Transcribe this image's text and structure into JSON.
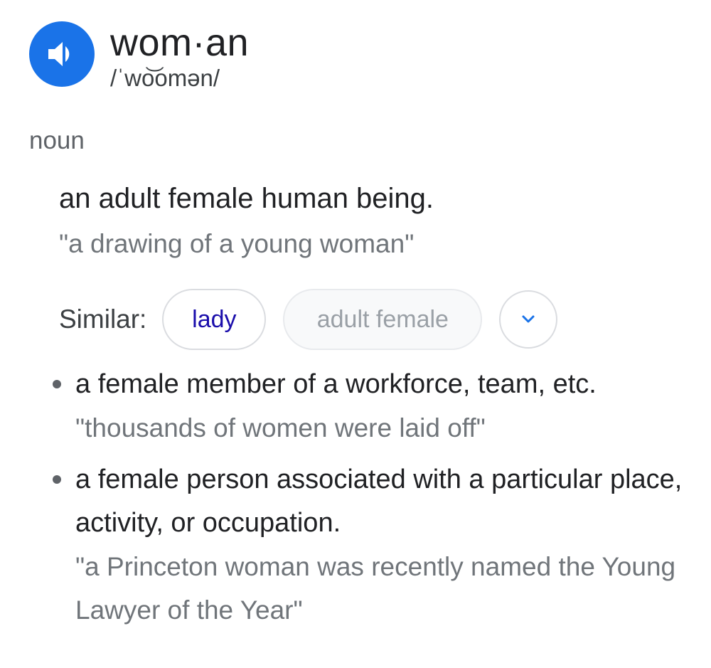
{
  "entry": {
    "headword": "wom·an",
    "pronunciation": "/ˈwo͝omən/",
    "part_of_speech": "noun",
    "speaker_icon": "speaker-volume-icon",
    "accent_color": "#1a73e8"
  },
  "primary_sense": {
    "definition": "an adult female human being.",
    "example": "\"a drawing of a young woman\""
  },
  "similar": {
    "label": "Similar:",
    "chips": [
      "lady",
      "adult female"
    ],
    "expand_icon": "chevron-down-icon"
  },
  "sub_senses": [
    {
      "definition": "a female member of a workforce, team, etc.",
      "example": "\"thousands of women were laid off\""
    },
    {
      "definition": "a female person associated with a particular place, activity, or occupation.",
      "example": "\"a Princeton woman was recently named the Young Lawyer of the Year\""
    }
  ]
}
